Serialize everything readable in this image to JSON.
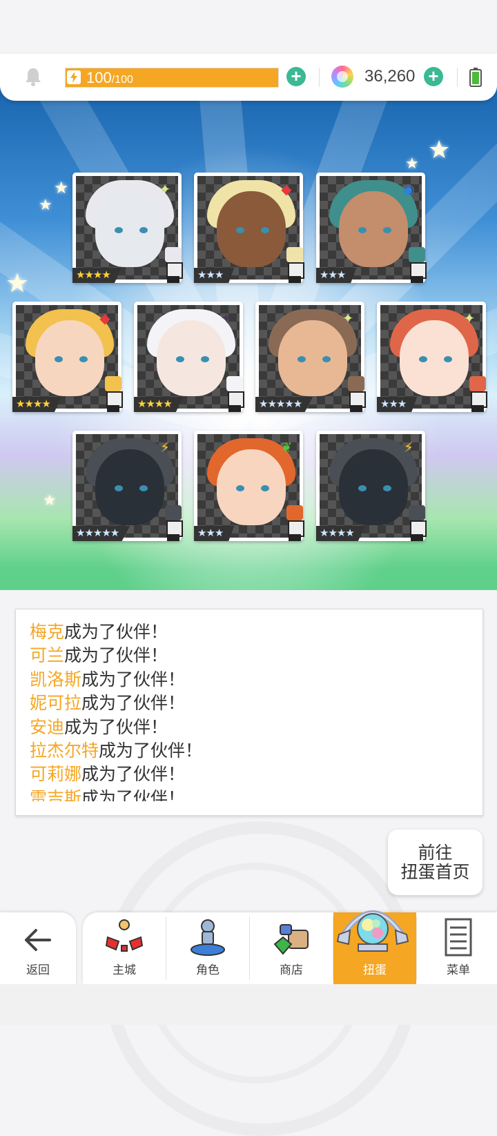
{
  "status_bar": {
    "energy_current": "100",
    "energy_max": "/100",
    "energy_fill_fraction": 1.0,
    "gem_count": "36,260",
    "icons": [
      "bell-icon",
      "bolt-icon",
      "add-energy-icon",
      "gem-icon",
      "add-gem-icon",
      "battery-icon"
    ],
    "accent_color": "#f5a623",
    "plus_color": "#3bb894"
  },
  "results": {
    "cards": [
      {
        "stars": "★★★★",
        "star_count": 4,
        "element": "sparkle",
        "frame": "gold",
        "hair": "#e8e8ee",
        "skin": "#e6e9ee"
      },
      {
        "stars": "★★★",
        "star_count": 3,
        "element": "fire",
        "frame": "silver",
        "hair": "#efe3a8",
        "skin": "#8a5a3a"
      },
      {
        "stars": "★★★",
        "star_count": 3,
        "element": "water",
        "frame": "silver",
        "hair": "#3f8f8c",
        "skin": "#c48d6c"
      },
      {
        "stars": "★★★★",
        "star_count": 4,
        "element": "fire",
        "frame": "gold",
        "hair": "#f2c14e",
        "skin": "#f7d6bf"
      },
      {
        "stars": "★★★★",
        "star_count": 4,
        "element": "dark",
        "frame": "gold",
        "hair": "#f4f4f8",
        "skin": "#f6e6e0"
      },
      {
        "stars": "★★★★★",
        "star_count": 5,
        "element": "sparkle",
        "frame": "silver",
        "hair": "#8b6a55",
        "skin": "#e8b894"
      },
      {
        "stars": "★★★",
        "star_count": 3,
        "element": "sparkle",
        "frame": "silver",
        "hair": "#e0664a",
        "skin": "#fbe1d3"
      },
      {
        "stars": "★★★★★",
        "star_count": 5,
        "element": "thunder",
        "frame": "silver",
        "hair": "#4a4f56",
        "skin": "#2a3038"
      },
      {
        "stars": "★★★",
        "star_count": 3,
        "element": "wind",
        "frame": "silver",
        "hair": "#e2672d",
        "skin": "#f8d5bf"
      },
      {
        "stars": "★★★★",
        "star_count": 4,
        "element": "thunder",
        "frame": "silver",
        "hair": "#4a4f56",
        "skin": "#2a3038"
      }
    ]
  },
  "log": {
    "suffix": "成为了伙伴！",
    "entries": [
      {
        "name": "梅克"
      },
      {
        "name": "可兰"
      },
      {
        "name": "凯洛斯"
      },
      {
        "name": "妮可拉"
      },
      {
        "name": "安迪"
      },
      {
        "name": "拉杰尔特"
      },
      {
        "name": "可莉娜"
      },
      {
        "name": "雷吉斯"
      }
    ]
  },
  "goto_button": {
    "line1": "前往",
    "line2": "扭蛋首页"
  },
  "nav": {
    "back_label": "返回",
    "tabs": [
      {
        "label": "主城",
        "icon": "town-icon"
      },
      {
        "label": "角色",
        "icon": "character-icon"
      },
      {
        "label": "商店",
        "icon": "shop-icon"
      },
      {
        "label": "扭蛋",
        "icon": "gacha-icon",
        "active": true
      },
      {
        "label": "菜单",
        "icon": "menu-icon"
      }
    ]
  }
}
